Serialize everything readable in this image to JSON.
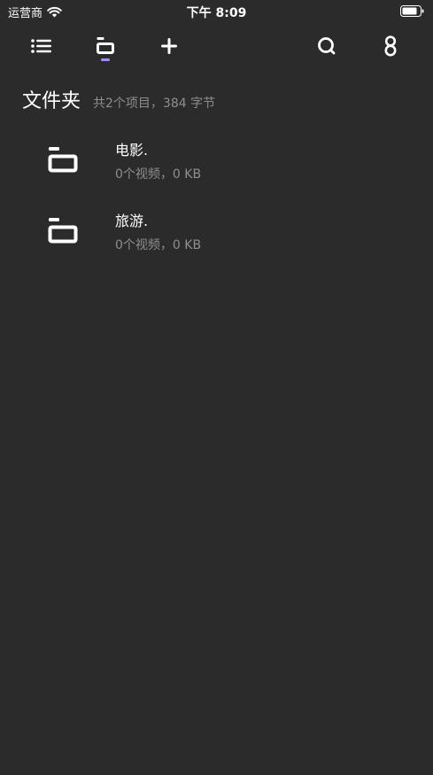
{
  "status_bar": {
    "carrier": "运营商",
    "time": "下午 8:09"
  },
  "toolbar": {
    "icons": [
      "list-icon",
      "folder-icon",
      "plus-icon",
      "search-icon",
      "user-icon"
    ],
    "active": "folder-icon",
    "accent_color": "#a78bfa"
  },
  "header": {
    "title": "文件夹",
    "summary": "共2个项目，384 字节"
  },
  "folders": [
    {
      "name": "电影.",
      "meta": "0个视频，0 KB"
    },
    {
      "name": "旅游.",
      "meta": "0个视频，0 KB"
    }
  ],
  "colors": {
    "background": "#2b2b2b",
    "primary_text": "#ffffff",
    "secondary_text": "#8e8e8e"
  }
}
